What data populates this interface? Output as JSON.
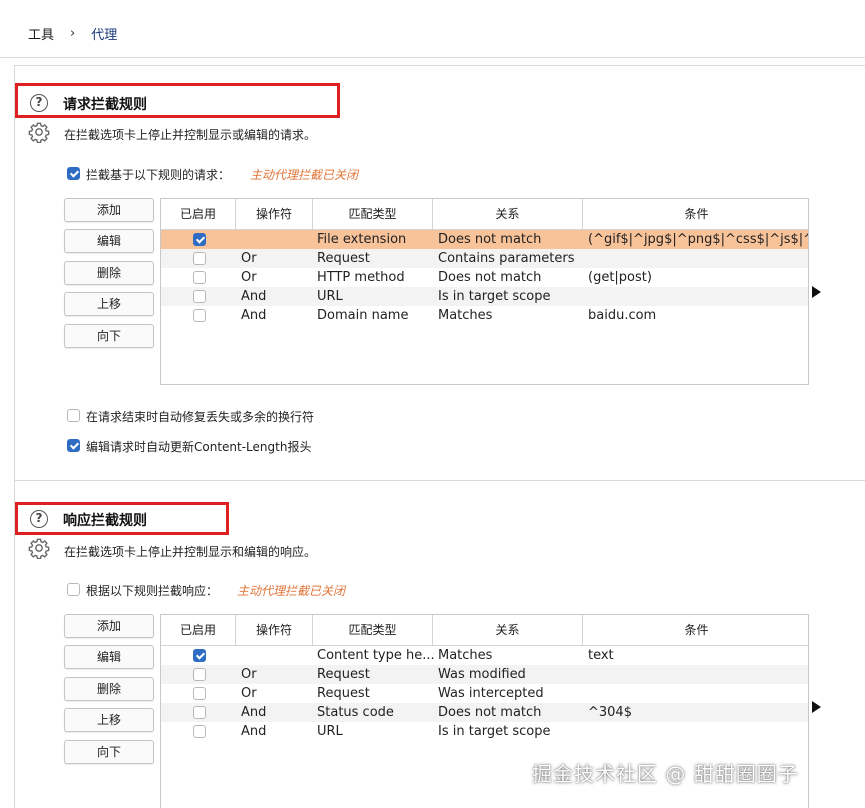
{
  "breadcrumb": {
    "parent": "工具",
    "current": "代理"
  },
  "request_section": {
    "title": "请求拦截规则",
    "description": "在拦截选项卡上停止并控制显示或编辑的请求。",
    "intercept_label": "拦截基于以下规则的请求：",
    "intercept_checked": true,
    "status_hint": "主动代理拦截已关闭",
    "buttons": [
      "添加",
      "编辑",
      "删除",
      "上移",
      "向下"
    ],
    "columns": [
      "已启用",
      "操作符",
      "匹配类型",
      "关系",
      "条件"
    ],
    "rows": [
      {
        "enabled": true,
        "operator": "",
        "match_type": "File extension",
        "relationship": "Does not match",
        "condition": "(^gif$|^jpg$|^png$|^css$|^js$|^...",
        "selected": true
      },
      {
        "enabled": false,
        "operator": "Or",
        "match_type": "Request",
        "relationship": "Contains parameters",
        "condition": ""
      },
      {
        "enabled": false,
        "operator": "Or",
        "match_type": "HTTP method",
        "relationship": "Does not match",
        "condition": "(get|post)"
      },
      {
        "enabled": false,
        "operator": "And",
        "match_type": "URL",
        "relationship": "Is in target scope",
        "condition": ""
      },
      {
        "enabled": false,
        "operator": "And",
        "match_type": "Domain name",
        "relationship": "Matches",
        "condition": "baidu.com"
      }
    ],
    "options": [
      {
        "label": "在请求结束时自动修复丢失或多余的换行符",
        "checked": false
      },
      {
        "label": "编辑请求时自动更新Content-Length报头",
        "checked": true
      }
    ]
  },
  "response_section": {
    "title": "响应拦截规则",
    "description": "在拦截选项卡上停止并控制显示和编辑的响应。",
    "intercept_label": "根据以下规则拦截响应：",
    "intercept_checked": false,
    "status_hint": "主动代理拦截已关闭",
    "buttons": [
      "添加",
      "编辑",
      "删除",
      "上移",
      "向下"
    ],
    "columns": [
      "已启用",
      "操作符",
      "匹配类型",
      "关系",
      "条件"
    ],
    "rows": [
      {
        "enabled": true,
        "operator": "",
        "match_type": "Content type he...",
        "relationship": "Matches",
        "condition": "text"
      },
      {
        "enabled": false,
        "operator": "Or",
        "match_type": "Request",
        "relationship": "Was modified",
        "condition": ""
      },
      {
        "enabled": false,
        "operator": "Or",
        "match_type": "Request",
        "relationship": "Was intercepted",
        "condition": ""
      },
      {
        "enabled": false,
        "operator": "And",
        "match_type": "Status code",
        "relationship": "Does not match",
        "condition": "^304$"
      },
      {
        "enabled": false,
        "operator": "And",
        "match_type": "URL",
        "relationship": "Is in target scope",
        "condition": ""
      }
    ]
  },
  "watermark": "掘金技术社区 @ 甜甜圈圈子",
  "colors": {
    "accent": "#2f6dc4",
    "highlight": "#e02020",
    "selected_row": "#f9c39a",
    "hint": "#e0753a"
  },
  "icons": [
    "help-icon",
    "gear-icon",
    "checkbox-icon",
    "arrow-right-icon"
  ]
}
